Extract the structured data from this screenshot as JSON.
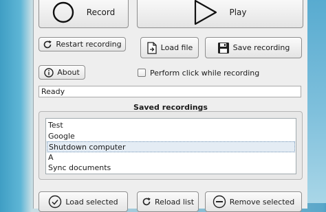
{
  "toolbar": {
    "record_label": "Record",
    "play_label": "Play",
    "restart_label": "Restart recording",
    "load_file_label": "Load file",
    "save_recording_label": "Save recording",
    "about_label": "About",
    "perform_click_label": "Perform click while recording",
    "perform_click_checked": false
  },
  "status": {
    "text": "Ready"
  },
  "saved_recordings": {
    "title": "Saved recordings",
    "items": [
      {
        "label": "Test"
      },
      {
        "label": "Google"
      },
      {
        "label": "Shutdown computer",
        "selected": true
      },
      {
        "label": "A"
      },
      {
        "label": "Sync documents"
      }
    ]
  },
  "bottom_buttons": {
    "load_selected_label": "Load selected",
    "reload_list_label": "Reload list",
    "remove_selected_label": "Remove selected"
  }
}
